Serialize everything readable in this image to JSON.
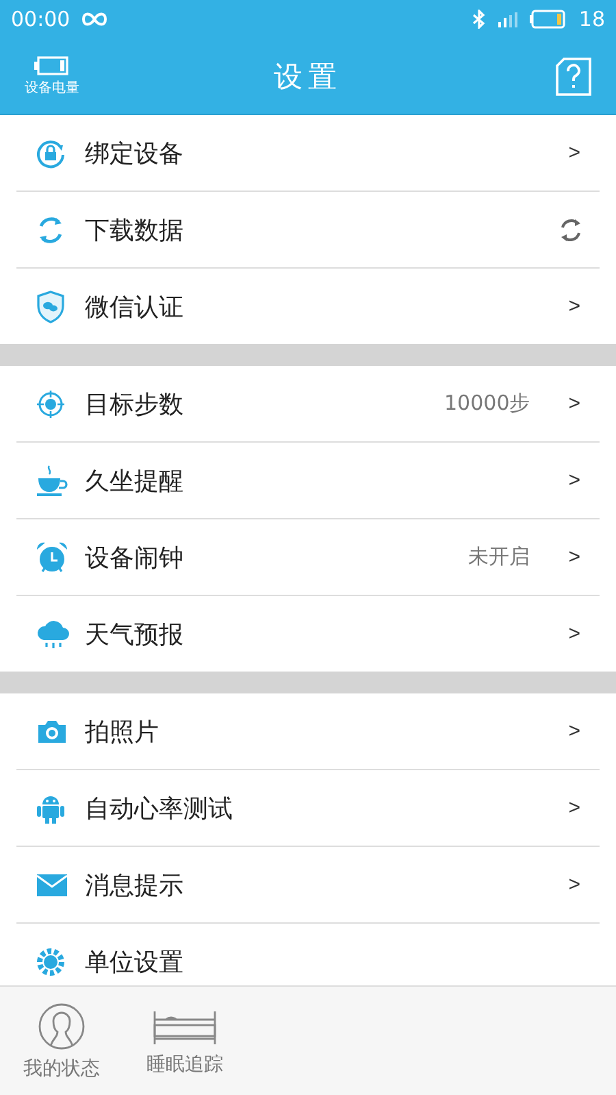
{
  "status_bar": {
    "time": "00:00",
    "battery": "18"
  },
  "header": {
    "battery_label": "设备电量",
    "title": "设置"
  },
  "sections": [
    {
      "items": [
        {
          "label": "绑定设备",
          "kind": "link",
          "chevron": ">"
        },
        {
          "label": "下载数据",
          "kind": "sync"
        },
        {
          "label": "微信认证",
          "kind": "link",
          "chevron": ">"
        }
      ]
    },
    {
      "items": [
        {
          "label": "目标步数",
          "kind": "link",
          "value": "10000步",
          "chevron": ">"
        },
        {
          "label": "久坐提醒",
          "kind": "link",
          "chevron": ">"
        },
        {
          "label": "设备闹钟",
          "kind": "link",
          "value": "未开启",
          "chevron": ">"
        },
        {
          "label": "天气预报",
          "kind": "link",
          "chevron": ">"
        }
      ]
    },
    {
      "items": [
        {
          "label": "拍照片",
          "kind": "link",
          "chevron": ">"
        },
        {
          "label": "自动心率测试",
          "kind": "link",
          "chevron": ">"
        },
        {
          "label": "消息提示",
          "kind": "link",
          "chevron": ">"
        },
        {
          "label": "单位设置",
          "kind": "link"
        }
      ]
    }
  ],
  "tab_bar": [
    {
      "label": "我的状态"
    },
    {
      "label": "睡眠追踪"
    }
  ]
}
